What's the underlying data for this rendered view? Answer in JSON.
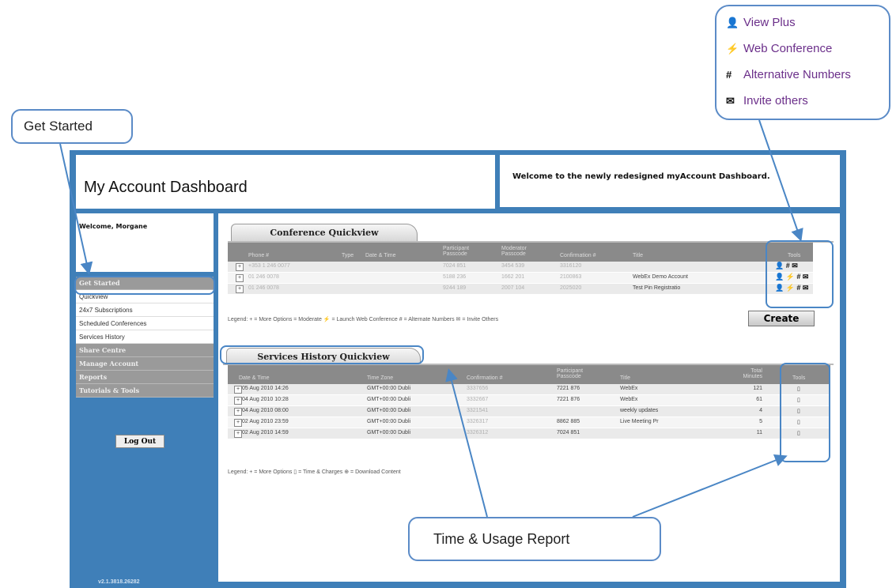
{
  "header": {
    "title": "My Account Dashboard",
    "welcome_message": "Welcome to the newly redesigned myAccount Dashboard."
  },
  "sidebar": {
    "welcome": "Welcome, Morgane",
    "items": [
      {
        "label": "Get Started",
        "type": "section"
      },
      {
        "label": "Quickview",
        "type": "sub"
      },
      {
        "label": "24x7 Subscriptions",
        "type": "sub"
      },
      {
        "label": "Scheduled Conferences",
        "type": "sub"
      },
      {
        "label": "Services History",
        "type": "sub"
      },
      {
        "label": "Share Centre",
        "type": "section"
      },
      {
        "label": "Manage Account",
        "type": "section"
      },
      {
        "label": "Reports",
        "type": "section"
      },
      {
        "label": "Tutorials & Tools",
        "type": "section"
      }
    ],
    "logout_label": "Log Out",
    "version": "v2.1.3818.26282"
  },
  "conference": {
    "tab_label": "Conference Quickview",
    "columns": [
      "Phone #",
      "Type",
      "Date & Time",
      "Participant Passcode",
      "Moderator Passcode",
      "Confirmation #",
      "Title",
      "Tools"
    ],
    "rows": [
      {
        "phone": "+353 1 246 0077",
        "participant": "7024 851",
        "moderator": "3454 539",
        "confirmation": "3316120",
        "title": "",
        "tools": "👤  # ✉"
      },
      {
        "phone": "01 246 0078",
        "participant": "5188 236",
        "moderator": "1662 201",
        "confirmation": "2100863",
        "title": "WebEx Demo Account",
        "tools": "👤 ⚡ # ✉"
      },
      {
        "phone": "01 246 0078",
        "participant": "9244 189",
        "moderator": "2007 104",
        "confirmation": "2025020",
        "title": "Test Pin Registratio",
        "tools": "👤 ⚡ # ✉"
      }
    ],
    "legend": "Legend:  + = More Options    = Moderate   ⚡ = Launch Web Conference   # = Alternate Numbers    ✉ = Invite Others",
    "create_label": "Create"
  },
  "services": {
    "tab_label": "Services History Quickview",
    "columns": [
      "Date & Time",
      "Time Zone",
      "Confirmation #",
      "Participant Passcode",
      "Title",
      "Total Minutes",
      "Tools"
    ],
    "rows": [
      {
        "date": "05 Aug 2010 14:26",
        "tz": "GMT+00:00 Dubli",
        "confirmation": "3337656",
        "passcode": "7221 876",
        "title": "WebEx",
        "minutes": "121"
      },
      {
        "date": "04 Aug 2010 10:28",
        "tz": "GMT+00:00 Dubli",
        "confirmation": "3332667",
        "passcode": "7221 876",
        "title": "WebEx",
        "minutes": "61"
      },
      {
        "date": "04 Aug 2010 08:00",
        "tz": "GMT+00:00 Dubli",
        "confirmation": "3321541",
        "passcode": "",
        "title": "weekly updates",
        "minutes": "4"
      },
      {
        "date": "02 Aug 2010 23:59",
        "tz": "GMT+00:00 Dubli",
        "confirmation": "3326317",
        "passcode": "8862 885",
        "title": "Live Meeting Pr",
        "minutes": "5"
      },
      {
        "date": "02 Aug 2010 14:59",
        "tz": "GMT+00:00 Dubli",
        "confirmation": "3326312",
        "passcode": "7024 851",
        "title": "",
        "minutes": "11"
      }
    ],
    "legend": "Legend:  + = More Options    ▯ = Time & Charges   ⊕ = Download Content"
  },
  "callouts": {
    "get_started": "Get Started",
    "time_usage": "Time & Usage Report",
    "tools_legend": [
      {
        "icon": "person-icon",
        "glyph": "👤",
        "label": "View Plus"
      },
      {
        "icon": "lightning-icon",
        "glyph": "⚡",
        "label": "Web Conference"
      },
      {
        "icon": "hash-icon",
        "glyph": "#",
        "label": "Alternative Numbers"
      },
      {
        "icon": "envelope-icon",
        "glyph": "✉",
        "label": "Invite others"
      }
    ]
  },
  "colors": {
    "frame": "#3f7fb8",
    "callout_border": "#5b8bc7",
    "tools_link": "#6b2f8a"
  }
}
